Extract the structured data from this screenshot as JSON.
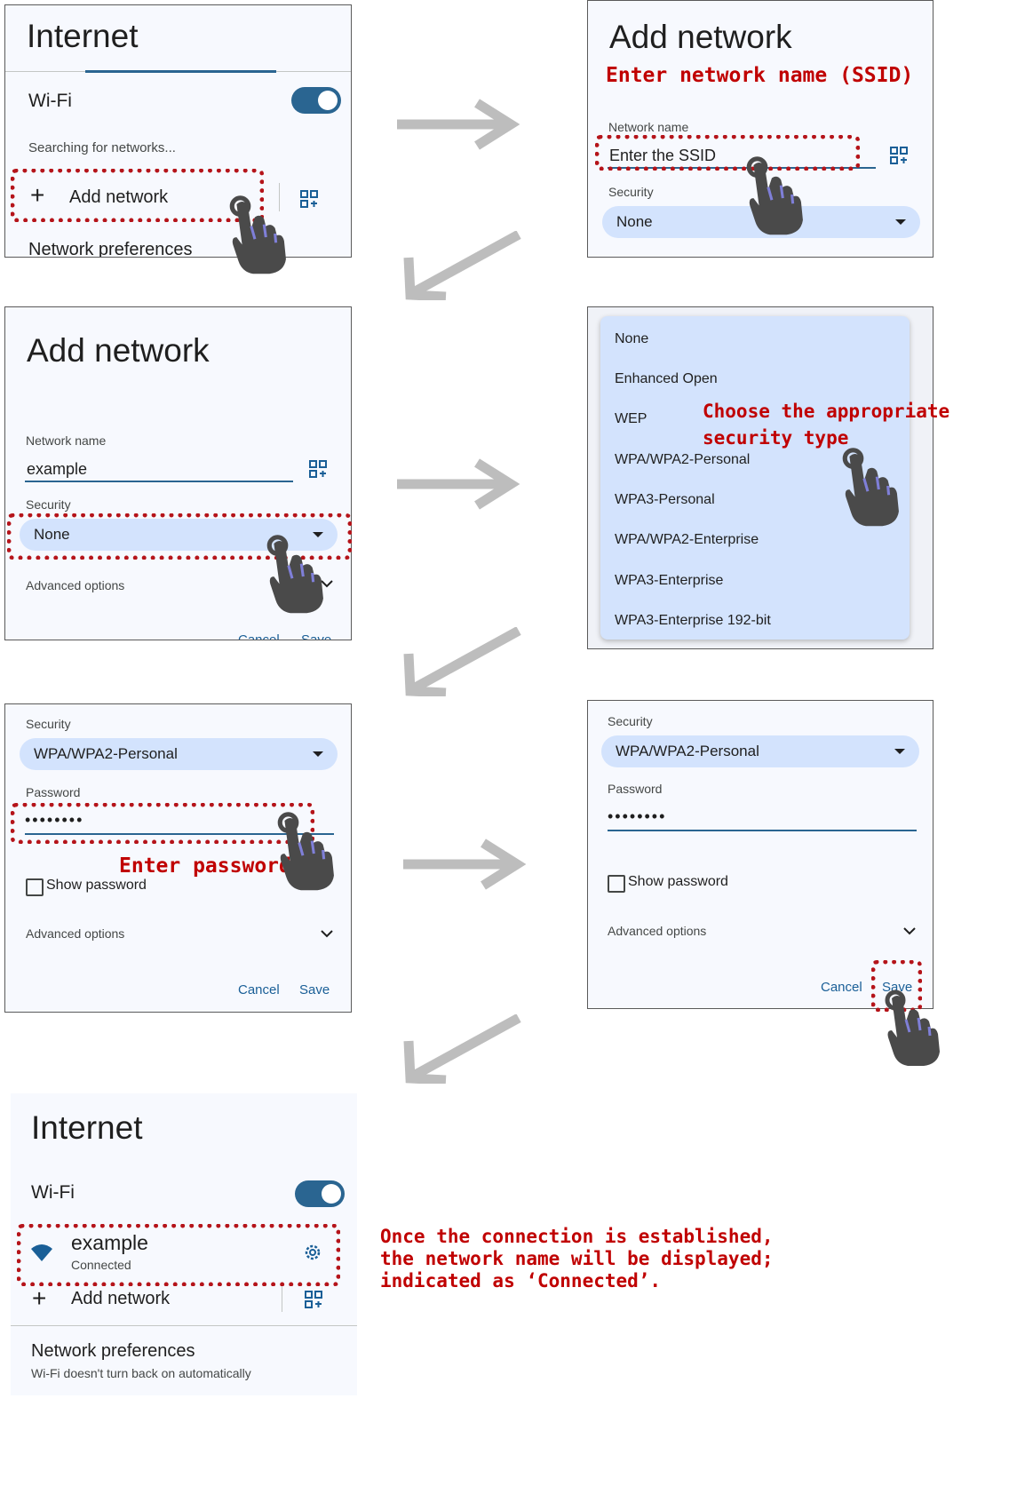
{
  "panel1": {
    "title": "Internet",
    "wifi_label": "Wi-Fi",
    "searching": "Searching for networks...",
    "add_network": "Add network",
    "network_preferences": "Network preferences"
  },
  "panel2": {
    "title": "Add network",
    "instruction": "Enter network name (SSID)",
    "network_name_label": "Network name",
    "ssid_placeholder": "Enter the SSID",
    "security_label": "Security",
    "security_value": "None"
  },
  "panel3": {
    "title": "Add network",
    "network_name_label": "Network name",
    "network_name_value": "example",
    "security_label": "Security",
    "security_value": "None",
    "advanced_options": "Advanced options",
    "cancel": "Cancel",
    "save": "Save"
  },
  "panel4": {
    "options": [
      "None",
      "Enhanced Open",
      "WEP",
      "WPA/WPA2-Personal",
      "WPA3-Personal",
      "WPA/WPA2-Enterprise",
      "WPA3-Enterprise",
      "WPA3-Enterprise 192-bit"
    ],
    "instruction_line1": "Choose the appropriate",
    "instruction_line2": "security type"
  },
  "panel5": {
    "security_label": "Security",
    "security_value": "WPA/WPA2-Personal",
    "password_label": "Password",
    "password_value": "••••••••",
    "instruction": "Enter password",
    "show_password": "Show password",
    "advanced_options": "Advanced options",
    "cancel": "Cancel",
    "save": "Save"
  },
  "panel6": {
    "security_label": "Security",
    "security_value": "WPA/WPA2-Personal",
    "password_label": "Password",
    "password_value": "••••••••",
    "show_password": "Show password",
    "advanced_options": "Advanced options",
    "cancel": "Cancel",
    "save": "Save"
  },
  "panel7": {
    "title": "Internet",
    "wifi_label": "Wi-Fi",
    "network_name": "example",
    "network_status": "Connected",
    "add_network": "Add network",
    "network_preferences": "Network preferences",
    "preferences_sub": "Wi-Fi doesn't turn back on automatically"
  },
  "final_note": {
    "line1": "Once the connection is established,",
    "line2": "the network name will be displayed;",
    "line3": "indicated as  ‘Connected’."
  },
  "colors": {
    "accent": "#2a6591",
    "select_bg": "#d3e3fd",
    "annotation_red": "#c00000",
    "arrow_gray": "#bdbdbd"
  },
  "icons": [
    "qr-scan-icon",
    "plus-icon",
    "hand-pointer-icon",
    "dropdown-caret-icon",
    "chevron-down-icon",
    "wifi-icon",
    "gear-icon",
    "flow-arrow-icon"
  ]
}
